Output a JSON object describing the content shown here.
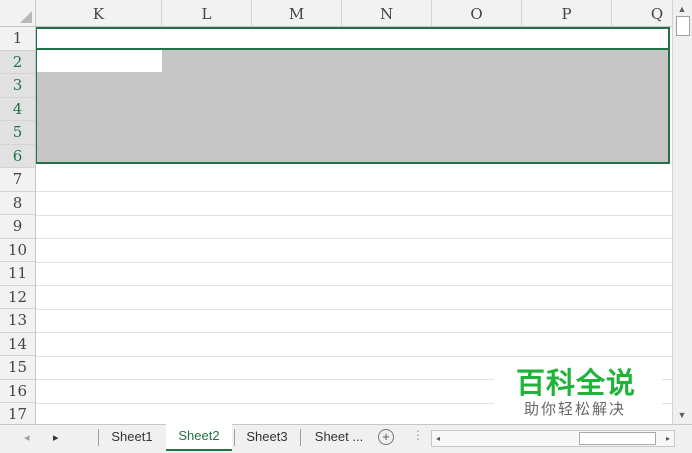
{
  "columns": [
    "K",
    "L",
    "M",
    "N",
    "O",
    "P",
    "Q"
  ],
  "rows": [
    "1",
    "2",
    "3",
    "4",
    "5",
    "6",
    "7",
    "8",
    "9",
    "10",
    "11",
    "12",
    "13",
    "14",
    "15",
    "16",
    "17"
  ],
  "selected_rows": [
    "2",
    "3",
    "4",
    "5",
    "6"
  ],
  "sheets": {
    "nav_prev": "◂",
    "nav_next": "▸",
    "tabs": [
      {
        "label": "Sheet1"
      },
      {
        "label": "Sheet2"
      },
      {
        "label": "Sheet3"
      },
      {
        "label": "Sheet ..."
      }
    ],
    "active": "Sheet2",
    "add_label": "+"
  },
  "scroll": {
    "up": "▲",
    "down": "▼",
    "left": "◂",
    "right": "▸",
    "more": "⋮"
  },
  "watermark": {
    "title": "百科全说",
    "subtitle": "助你轻松解决"
  },
  "colors": {
    "accent": "#217346",
    "selection_fill": "#c6c6c6",
    "watermark_green": "#20b33a"
  }
}
